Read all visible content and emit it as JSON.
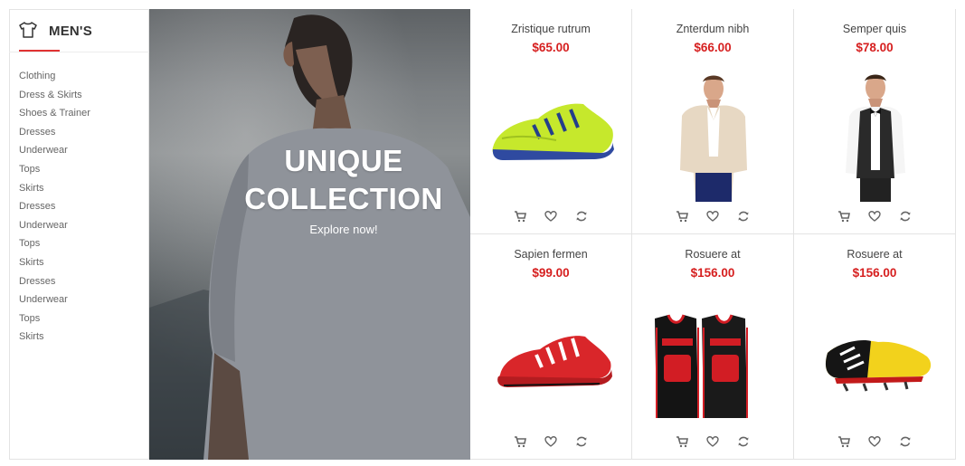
{
  "sidebar": {
    "title": "MEN'S",
    "icon": "shirt-icon",
    "accent_color": "#e03232",
    "items": [
      {
        "label": "Clothing"
      },
      {
        "label": "Dress & Skirts"
      },
      {
        "label": "Shoes & Trainer"
      },
      {
        "label": "Dresses"
      },
      {
        "label": "Underwear"
      },
      {
        "label": "Tops"
      },
      {
        "label": "Skirts"
      },
      {
        "label": "Dresses"
      },
      {
        "label": "Underwear"
      },
      {
        "label": "Tops"
      },
      {
        "label": "Skirts"
      },
      {
        "label": "Dresses"
      },
      {
        "label": "Underwear"
      },
      {
        "label": "Tops"
      },
      {
        "label": "Skirts"
      }
    ]
  },
  "banner": {
    "heading_line1": "UNIQUE",
    "heading_line2": "COLLECTION",
    "cta": "Explore now!"
  },
  "products": [
    {
      "name": "Zristique rutrum",
      "price": "$65.00",
      "image": "lime-green-running-shoe"
    },
    {
      "name": "Znterdum nibh",
      "price": "$66.00",
      "image": "man-in-beige-blazer"
    },
    {
      "name": "Semper quis",
      "price": "$78.00",
      "image": "man-in-tuxedo-vest"
    },
    {
      "name": "Sapien fermen",
      "price": "$99.00",
      "image": "red-running-shoe"
    },
    {
      "name": "Rosuere at",
      "price": "$156.00",
      "image": "bulls-basketball-jerseys"
    },
    {
      "name": "Rosuere at",
      "price": "$156.00",
      "image": "yellow-football-boot"
    }
  ],
  "product_actions": [
    "cart-icon",
    "heart-icon",
    "refresh-icon"
  ],
  "price_color": "#d61f1f"
}
